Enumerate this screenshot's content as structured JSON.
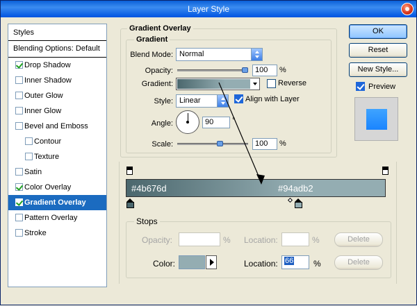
{
  "window": {
    "title": "Layer Style"
  },
  "styles_panel": {
    "header": "Styles",
    "blending_options": "Blending Options: Default",
    "items": [
      {
        "label": "Drop Shadow",
        "checked": true
      },
      {
        "label": "Inner Shadow",
        "checked": false
      },
      {
        "label": "Outer Glow",
        "checked": false
      },
      {
        "label": "Inner Glow",
        "checked": false
      },
      {
        "label": "Bevel and Emboss",
        "checked": false
      },
      {
        "label": "Contour",
        "checked": false
      },
      {
        "label": "Texture",
        "checked": false
      },
      {
        "label": "Satin",
        "checked": false
      },
      {
        "label": "Color Overlay",
        "checked": true
      },
      {
        "label": "Gradient Overlay",
        "checked": true,
        "selected": true
      },
      {
        "label": "Pattern Overlay",
        "checked": false
      },
      {
        "label": "Stroke",
        "checked": false
      }
    ]
  },
  "gradient_overlay": {
    "group_title": "Gradient Overlay",
    "subgroup_title": "Gradient",
    "blend_mode_label": "Blend Mode:",
    "blend_mode_value": "Normal",
    "opacity_label": "Opacity:",
    "opacity_value": "100",
    "opacity_unit": "%",
    "gradient_label": "Gradient:",
    "reverse_label": "Reverse",
    "style_label": "Style:",
    "style_value": "Linear",
    "align_label": "Align with Layer",
    "angle_label": "Angle:",
    "angle_value": "90",
    "angle_unit": "°",
    "scale_label": "Scale:",
    "scale_value": "100",
    "scale_unit": "%"
  },
  "gradient_editor": {
    "start_color": "#4b676d",
    "end_color": "#94adb2",
    "start_hex_label": "#4b676d",
    "end_hex_label": "#94adb2",
    "stops_title": "Stops",
    "opacity_label": "Opacity:",
    "opacity_unit": "%",
    "location_label_top": "Location:",
    "location_unit_top": "%",
    "delete_top": "Delete",
    "color_label": "Color:",
    "location_label": "Location:",
    "location_value": "66",
    "location_unit": "%",
    "delete_bottom": "Delete"
  },
  "buttons": {
    "ok": "OK",
    "reset": "Reset",
    "new_style": "New Style...",
    "preview_label": "Preview"
  }
}
